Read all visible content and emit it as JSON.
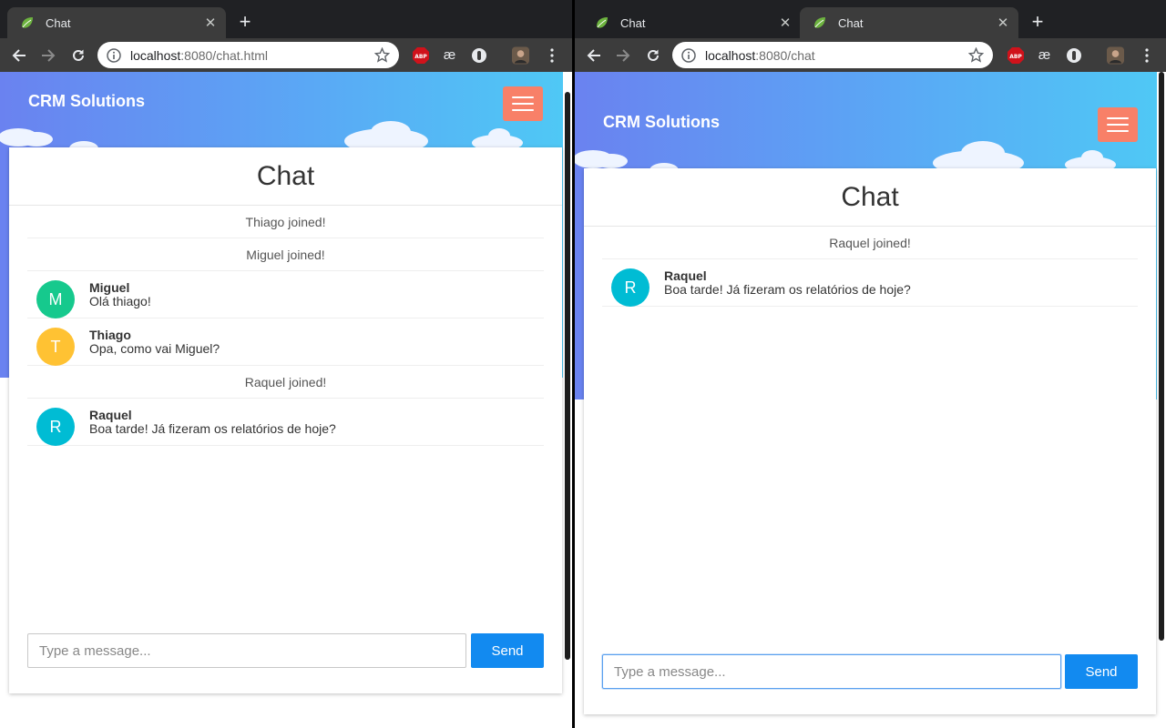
{
  "left": {
    "tabs": [
      {
        "title": "Chat",
        "active": true
      },
      {
        "title": "+"
      }
    ],
    "url": {
      "host": "localhost",
      "rest": ":8080/chat.html"
    },
    "brand": "CRM Solutions",
    "chat_title": "Chat",
    "messages": [
      {
        "type": "event",
        "text": "Thiago joined!"
      },
      {
        "type": "event",
        "text": "Miguel joined!"
      },
      {
        "type": "chat",
        "initial": "M",
        "sender": "Miguel",
        "text": "Olá thiago!",
        "color": "#16c98d"
      },
      {
        "type": "chat",
        "initial": "T",
        "sender": "Thiago",
        "text": "Opa, como vai Miguel?",
        "color": "#ffc233"
      },
      {
        "type": "event",
        "text": "Raquel joined!"
      },
      {
        "type": "chat",
        "initial": "R",
        "sender": "Raquel",
        "text": "Boa tarde! Já fizeram os relatórios de hoje?",
        "color": "#00bcd4"
      }
    ],
    "input_placeholder": "Type a message...",
    "send_label": "Send"
  },
  "right": {
    "tabs": [
      {
        "title": "Chat",
        "active": false
      },
      {
        "title": "Chat",
        "active": true
      }
    ],
    "url": {
      "host": "localhost",
      "rest": ":8080/chat"
    },
    "brand": "CRM Solutions",
    "chat_title": "Chat",
    "messages": [
      {
        "type": "event",
        "text": "Raquel joined!"
      },
      {
        "type": "chat",
        "initial": "R",
        "sender": "Raquel",
        "text": "Boa tarde! Já fizeram os relatórios de hoje?",
        "color": "#00bcd4"
      }
    ],
    "input_placeholder": "Type a message...",
    "send_label": "Send"
  },
  "icons": {
    "favicon": "spring-leaf-icon",
    "back": "back-arrow-icon",
    "forward": "forward-arrow-icon",
    "reload": "reload-icon",
    "info": "info-icon",
    "bookmark": "star-icon",
    "adblock": "abp-icon",
    "ae": "ae-extension-icon",
    "ext3": "circle-extension-icon",
    "profile": "profile-avatar-icon",
    "menu": "kebab-menu-icon",
    "close": "close-icon",
    "hamburger": "hamburger-menu-icon"
  },
  "colors": {
    "hero_start": "#6a82f0",
    "hero_end": "#4fc8f5",
    "hamburger_bg": "#f88068",
    "send_bg": "#128af0"
  }
}
